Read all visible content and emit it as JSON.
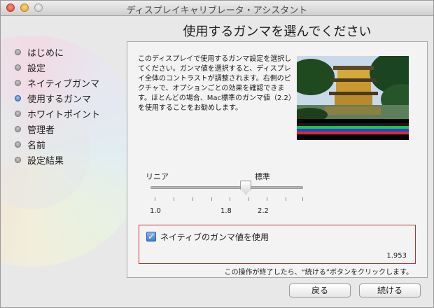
{
  "window": {
    "title": "ディスプレイキャリブレータ・アシスタント"
  },
  "page": {
    "heading": "使用するガンマを選んでください"
  },
  "steps": [
    {
      "label": "はじめに"
    },
    {
      "label": "設定"
    },
    {
      "label": "ネイティブガンマ"
    },
    {
      "label": "使用するガンマ"
    },
    {
      "label": "ホワイトポイント"
    },
    {
      "label": "管理者"
    },
    {
      "label": "名前"
    },
    {
      "label": "設定結果"
    }
  ],
  "active_step": 3,
  "panel": {
    "description": "このディスプレイで使用するガンマ設定を選択してください。ガンマ値を選択すると、ディスプレイ全体のコントラストが調整されます。右側のピクチャで、オプションごとの効果を確認できます。ほとんどの場合、Mac標準のガンマ値（2.2）を使用することをお勧めします。",
    "slider": {
      "left_label": "リニア",
      "right_label": "標準",
      "ticks": [
        "1.0",
        "1.8",
        "2.2"
      ],
      "value": 2.0,
      "min": 1.0,
      "max": 2.6
    },
    "native": {
      "checkbox_label": "ネイティブのガンマ値を使用",
      "checked": true,
      "value": "1.953"
    },
    "note": "この操作が終了したら、“続ける”ボタンをクリックします。"
  },
  "buttons": {
    "back": "戻る",
    "continue": "続ける"
  },
  "colors": {
    "accent": "#3a76cf",
    "highlight_border": "#c4302b"
  }
}
